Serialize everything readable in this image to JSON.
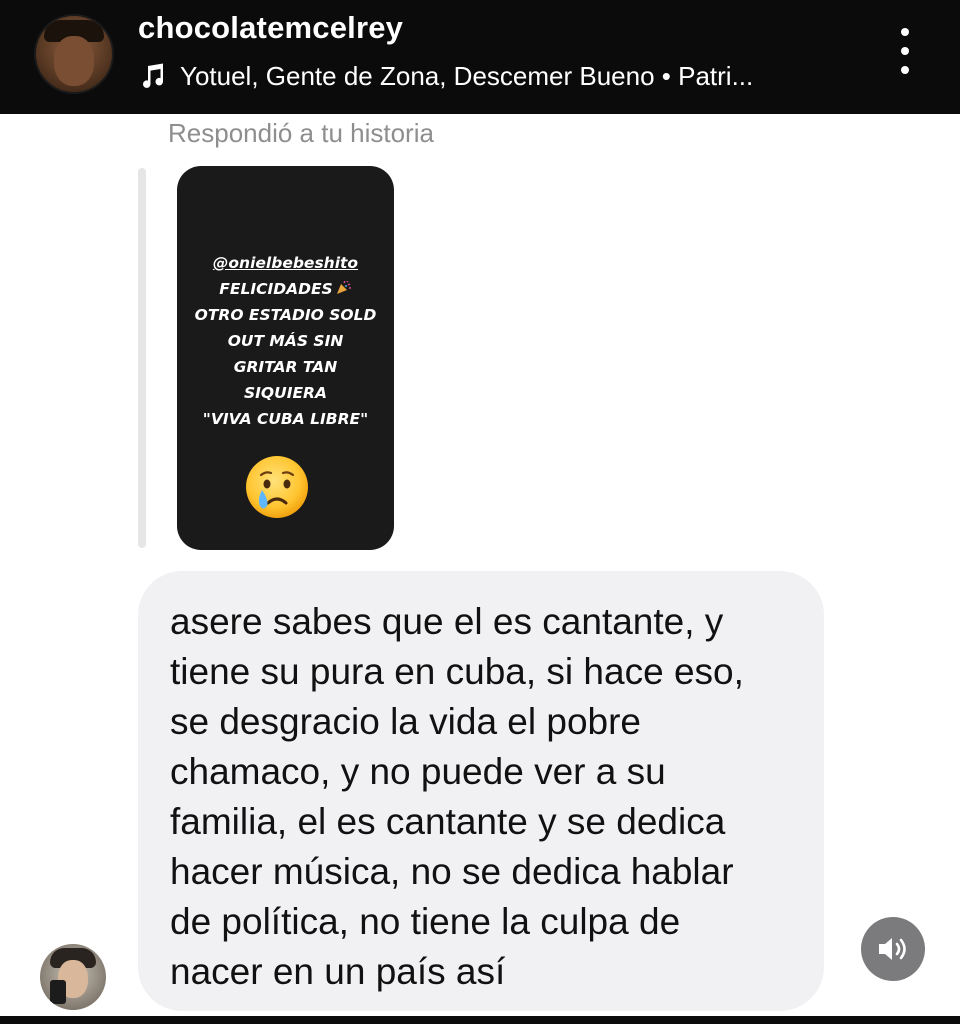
{
  "header": {
    "username": "chocolatemcelrey",
    "music_text": "Yotuel, Gente de Zona, Descemer Bueno • Patri...",
    "avatar_icon": "user-avatar",
    "music_icon": "music-note-icon",
    "more_icon": "more-vertical-icon",
    "background_color": "#0b0b0b"
  },
  "conversation": {
    "replied_label": "Respondió a tu historia",
    "story": {
      "mention": "@onielbebeshito",
      "line1": "FELICIDADES",
      "line2": "OTRO ESTADIO SOLD",
      "line3": "OUT MÁS SIN",
      "line4": "GRITAR TAN",
      "line5": "SIQUIERA",
      "line6": "\"VIVA CUBA LIBRE\"",
      "emoji_icon": "crying-face-emoji",
      "party_icon": "party-popper-emoji",
      "background_color": "#1a1a1a"
    },
    "message": {
      "text": "asere sabes que el es cantante, y\ntiene su pura en cuba, si hace eso,\nse desgracio la vida el pobre\nchamaco, y no puede ver a su\nfamilia, el es cantante y se dedica\nhacer música, no se dedica hablar\nde política, no tiene la culpa de\nnacer en un país así",
      "bubble_color": "#f1f1f3"
    },
    "sender_avatar_icon": "user-avatar",
    "audio_icon": "speaker-icon"
  }
}
